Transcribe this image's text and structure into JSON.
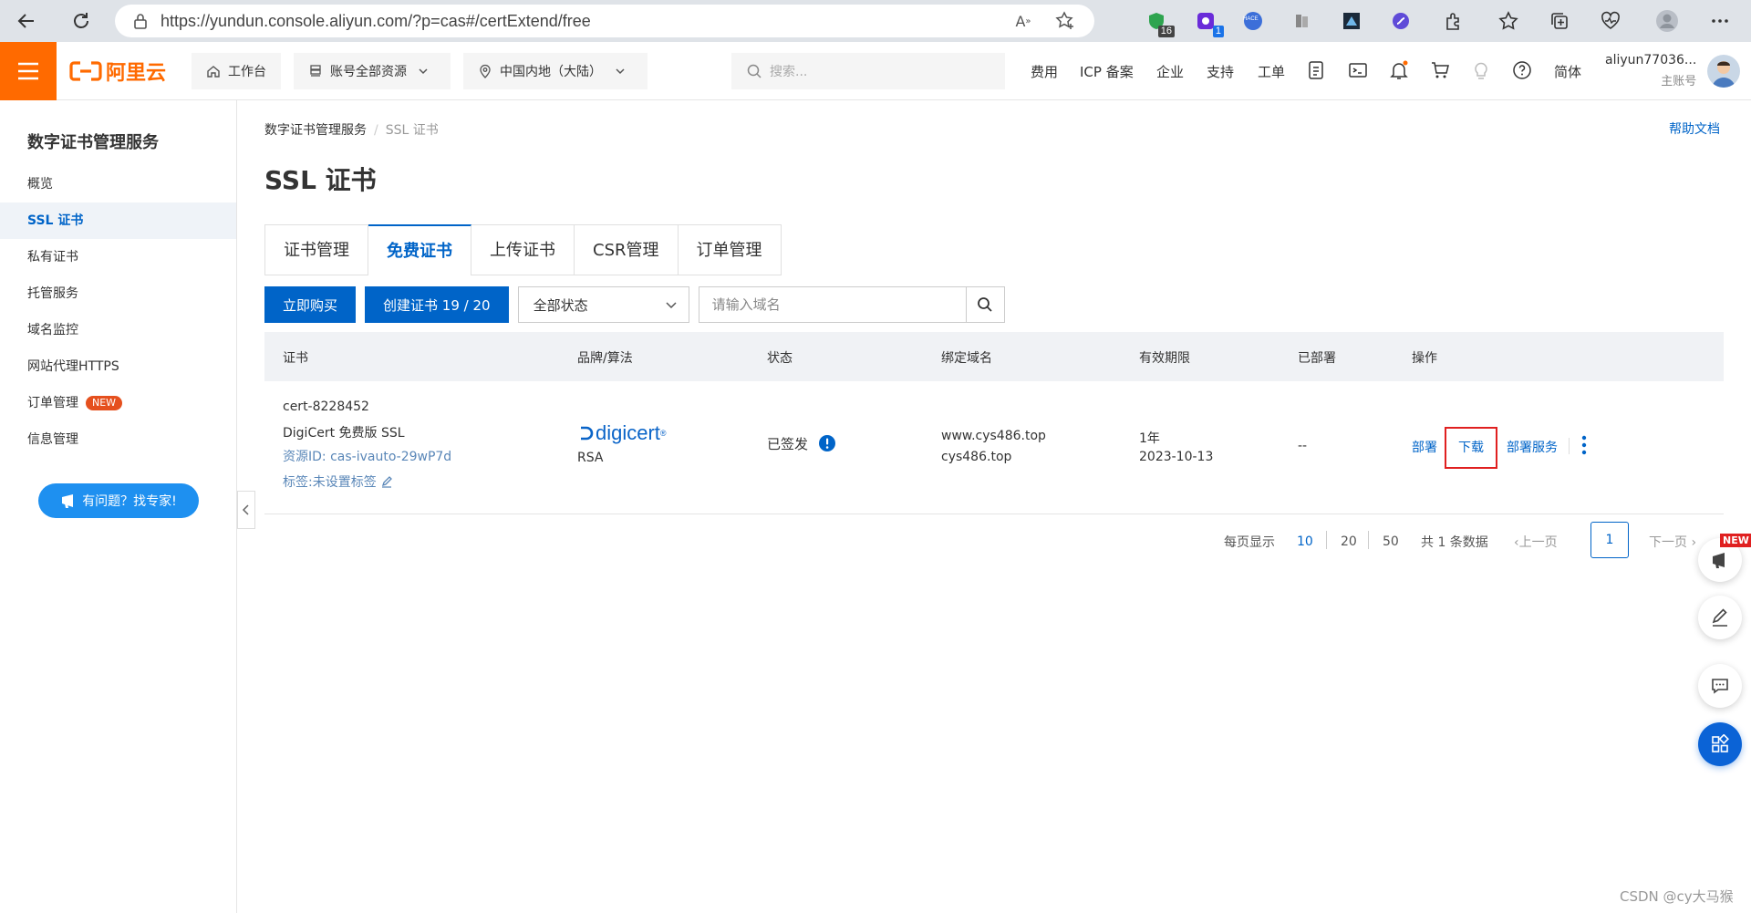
{
  "browser": {
    "url": "https://yundun.console.aliyun.com/?p=cas#/certExtend/free",
    "ext_badges": [
      "16",
      "1"
    ],
    "ext_text": "HACE"
  },
  "topbar": {
    "logo_text": "阿里云",
    "workbench": "工作台",
    "resources": "账号全部资源",
    "region": "中国内地（大陆）",
    "search_placeholder": "搜索...",
    "links": [
      "费用",
      "ICP 备案",
      "企业",
      "支持",
      "工单"
    ],
    "language": "简体",
    "user_name": "aliyun77036...",
    "user_role": "主账号"
  },
  "sidebar": {
    "title": "数字证书管理服务",
    "items": [
      {
        "label": "概览"
      },
      {
        "label": "SSL 证书"
      },
      {
        "label": "私有证书"
      },
      {
        "label": "托管服务"
      },
      {
        "label": "域名监控"
      },
      {
        "label": "网站代理HTTPS"
      },
      {
        "label": "订单管理"
      },
      {
        "label": "信息管理"
      }
    ],
    "new_badge": "NEW",
    "expert_button": "有问题？找专家!"
  },
  "breadcrumb": {
    "root": "数字证书管理服务",
    "current": "SSL 证书"
  },
  "help_doc": "帮助文档",
  "page_title": "SSL 证书",
  "tabs": [
    "证书管理",
    "免费证书",
    "上传证书",
    "CSR管理",
    "订单管理"
  ],
  "toolbar": {
    "buy_button": "立即购买",
    "create_button": "创建证书 19 / 20",
    "status_select": "全部状态",
    "domain_placeholder": "请输入域名"
  },
  "table": {
    "columns": [
      "证书",
      "品牌/算法",
      "状态",
      "绑定域名",
      "有效期限",
      "已部署",
      "操作"
    ],
    "row": {
      "cert_name": "cert-8228452",
      "cert_type": "DigiCert 免费版 SSL",
      "resource_id": "资源ID: cas-ivauto-29wP7d",
      "tag": "标签:未设置标签",
      "brand_logo": "digicert",
      "algorithm": "RSA",
      "status": "已签发",
      "domains": [
        "www.cys486.top",
        "cys486.top"
      ],
      "validity": "1年",
      "expiry": "2023-10-13",
      "deployed": "--",
      "actions": [
        "部署",
        "下载",
        "部署服务"
      ]
    }
  },
  "pagination": {
    "per_page_label": "每页显示",
    "sizes": [
      "10",
      "20",
      "50"
    ],
    "total": "共 1 条数据",
    "prev": "上一页",
    "page": "1",
    "next": "下一页"
  },
  "float_new_badge": "NEW",
  "watermark": "CSDN @cy大马猴",
  "colors": {
    "brand_orange": "#ff6a00",
    "primary_blue": "#0064c8",
    "highlight_red": "#e02020"
  }
}
